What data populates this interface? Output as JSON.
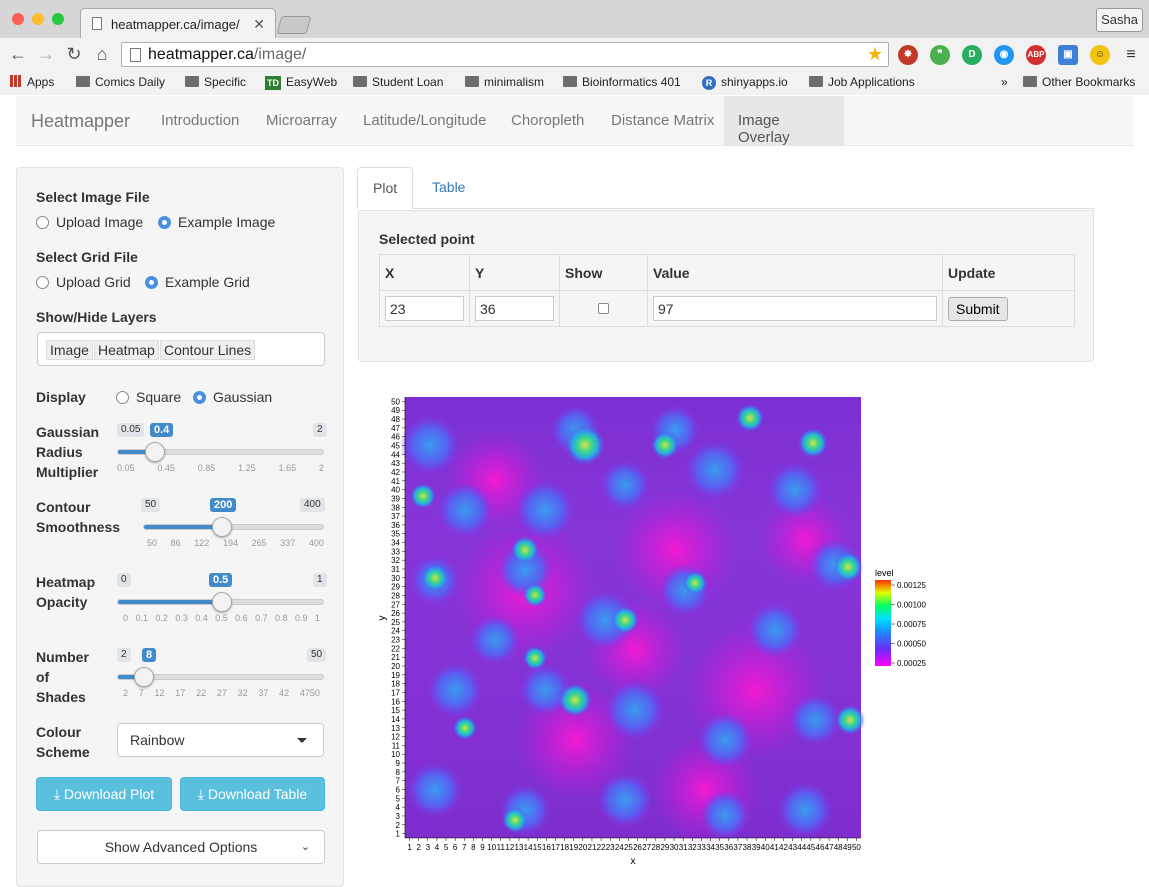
{
  "browser": {
    "tab_title": "heatmapper.ca/image/",
    "url_host": "heatmapper.ca",
    "url_path": "/image/",
    "user": "Sasha",
    "bookmarks": [
      "Apps",
      "Comics Daily",
      "Specific",
      "EasyWeb",
      "Student Loan",
      "minimalism",
      "Bioinformatics 401",
      "shinyapps.io",
      "Job Applications"
    ],
    "more": "»",
    "other_bookmarks": "Other Bookmarks",
    "extensions": [
      "ABP"
    ]
  },
  "navbar": {
    "brand": "Heatmapper",
    "items": [
      "Introduction",
      "Microarray",
      "Latitude/Longitude",
      "Choropleth",
      "Distance Matrix",
      "Image Overlay"
    ],
    "active": "Image Overlay"
  },
  "sidebar": {
    "image_file_label": "Select Image File",
    "image_options": [
      "Upload Image",
      "Example Image"
    ],
    "image_selected": "Example Image",
    "grid_file_label": "Select Grid File",
    "grid_options": [
      "Upload Grid",
      "Example Grid"
    ],
    "grid_selected": "Example Grid",
    "layers_label": "Show/Hide Layers",
    "layers": [
      "Image",
      "Heatmap",
      "Contour Lines"
    ],
    "display_label": "Display",
    "display_options": [
      "Square",
      "Gaussian"
    ],
    "display_selected": "Gaussian",
    "sliders": [
      {
        "label": [
          "Gaussian",
          "Radius",
          "Multiplier"
        ],
        "min": "0.05",
        "max": "2",
        "value": "0.4",
        "fraction": 0.18,
        "ticks": [
          "0.05",
          "0.45",
          "0.85",
          "1.25",
          "1.65",
          "2"
        ]
      },
      {
        "label": [
          "Contour",
          "Smoothness"
        ],
        "min": "50",
        "max": "400",
        "value": "200",
        "fraction": 0.43,
        "ticks": [
          "50",
          "86",
          "122",
          "194",
          "265",
          "337",
          "400"
        ]
      },
      {
        "label": [
          "Heatmap",
          "Opacity"
        ],
        "min": "0",
        "max": "1",
        "value": "0.5",
        "fraction": 0.5,
        "ticks": [
          "0",
          "0.1",
          "0.2",
          "0.3",
          "0.4",
          "0.5",
          "0.6",
          "0.7",
          "0.8",
          "0.9",
          "1"
        ]
      },
      {
        "label": [
          "Number",
          "of",
          "Shades"
        ],
        "min": "2",
        "max": "50",
        "value": "8",
        "fraction": 0.125,
        "ticks": [
          "2",
          "7",
          "12",
          "17",
          "22",
          "27",
          "32",
          "37",
          "42",
          "4750"
        ]
      }
    ],
    "colour_label": [
      "Colour",
      "Scheme"
    ],
    "colour_value": "Rainbow",
    "download_plot": "Download Plot",
    "download_table": "Download Table",
    "advanced": "Show Advanced Options"
  },
  "main": {
    "tabs": [
      "Plot",
      "Table"
    ],
    "active_tab": "Plot",
    "selected_point_label": "Selected point",
    "table_headers": [
      "X",
      "Y",
      "Show",
      "Value",
      "Update"
    ],
    "x_value": "23",
    "y_value": "36",
    "show_checked": false,
    "value": "97",
    "submit_label": "Submit"
  },
  "plot": {
    "xlabel": "x",
    "ylabel": "y",
    "legend_title": "level",
    "legend_levels": [
      "0.00125",
      "0.00100",
      "0.00075",
      "0.00050",
      "0.00025"
    ],
    "axis_range": [
      1,
      50
    ]
  }
}
